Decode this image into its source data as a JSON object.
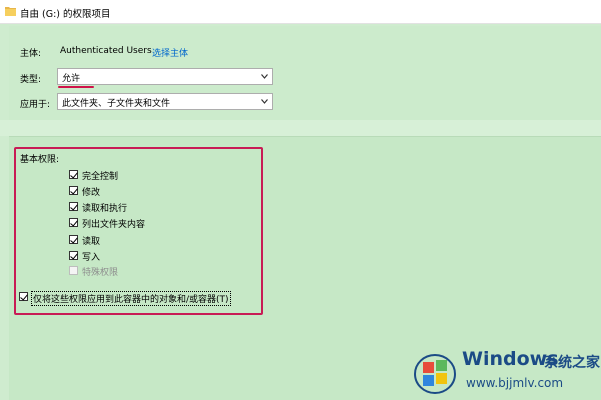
{
  "window": {
    "title": "自由 (G:) 的权限项目",
    "icon": "folder-icon"
  },
  "principal": {
    "label": "主体:",
    "value": "Authenticated Users",
    "select_link": "选择主体"
  },
  "type_field": {
    "label": "类型:",
    "value": "允许"
  },
  "applies_to": {
    "label": "应用于:",
    "value": "此文件夹、子文件夹和文件"
  },
  "basic_permissions": {
    "heading": "基本权限:",
    "items": [
      {
        "label": "完全控制",
        "checked": true,
        "disabled": false
      },
      {
        "label": "修改",
        "checked": true,
        "disabled": false
      },
      {
        "label": "读取和执行",
        "checked": true,
        "disabled": false
      },
      {
        "label": "列出文件夹内容",
        "checked": true,
        "disabled": false
      },
      {
        "label": "读取",
        "checked": true,
        "disabled": false
      },
      {
        "label": "写入",
        "checked": true,
        "disabled": false
      },
      {
        "label": "特殊权限",
        "checked": false,
        "disabled": true
      }
    ]
  },
  "apply_only": {
    "label": "仅将这些权限应用到此容器中的对象和/或容器(T)",
    "checked": true
  },
  "watermark": {
    "brand": "Windows",
    "cn": "系统之家",
    "url": "www.bjjmlv.com"
  },
  "colors": {
    "accent_red": "#c81b55",
    "link": "#0066cc",
    "panel": "#c6e8c6"
  }
}
